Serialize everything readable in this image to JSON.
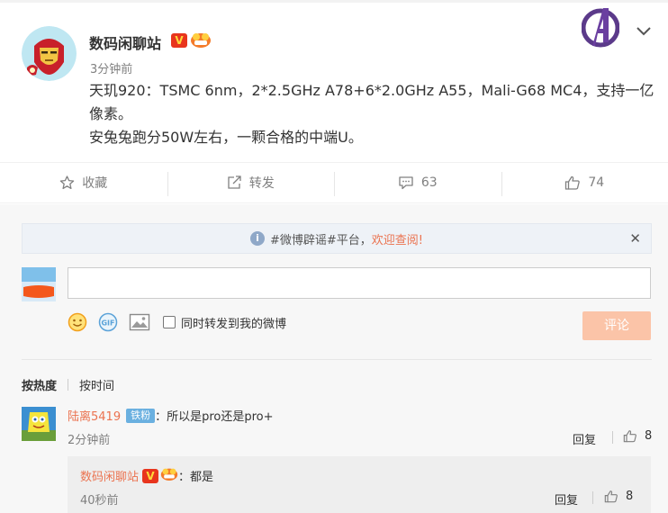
{
  "post": {
    "author": "数码闲聊站",
    "verified_badge": "V",
    "time": "3分钟前",
    "text_line1": "天玑920：TSMC 6nm，2*2.5GHz A78+6*2.0GHz A55，Mali-G68 MC4，支持一亿像素。",
    "text_line2": "安兔兔跑分50W左右，一颗合格的中端U。"
  },
  "actions": {
    "favorite_label": "收藏",
    "repost_label": "转发",
    "comment_count": "63",
    "like_count": "74"
  },
  "notice": {
    "prefix": "#微博辟谣#平台，",
    "link": "欢迎查阅!",
    "close": "✕"
  },
  "composer": {
    "input_value": "",
    "share_checkbox_label": "同时转发到我的微博",
    "submit_label": "评论"
  },
  "sort": {
    "hot_label": "按热度",
    "time_label": "按时间"
  },
  "comments": [
    {
      "user": "陆离5419",
      "badge": "铁粉",
      "text": "：所以是pro还是pro+",
      "time": "2分钟前",
      "reply_label": "回复",
      "likes": "8",
      "reply": {
        "user": "数码闲聊站",
        "verified_badge": "V",
        "text": "：都是",
        "time": "40秒前",
        "reply_label": "回复",
        "likes": "8"
      }
    }
  ],
  "colors": {
    "accent": "#eb7350",
    "submit_disabled": "#fbc4a8",
    "panel_bg": "#f7f7f7",
    "fan_badge": "#6ab0e0",
    "verified_red": "#e8351d"
  },
  "icons": {
    "favorite": "star-icon",
    "repost": "share-icon",
    "comment": "comment-icon",
    "like": "thumbs-up-icon",
    "emoji": "emoji-icon",
    "gif": "gif-icon",
    "image": "image-icon",
    "dropdown": "chevron-down-icon",
    "info": "info-icon"
  }
}
